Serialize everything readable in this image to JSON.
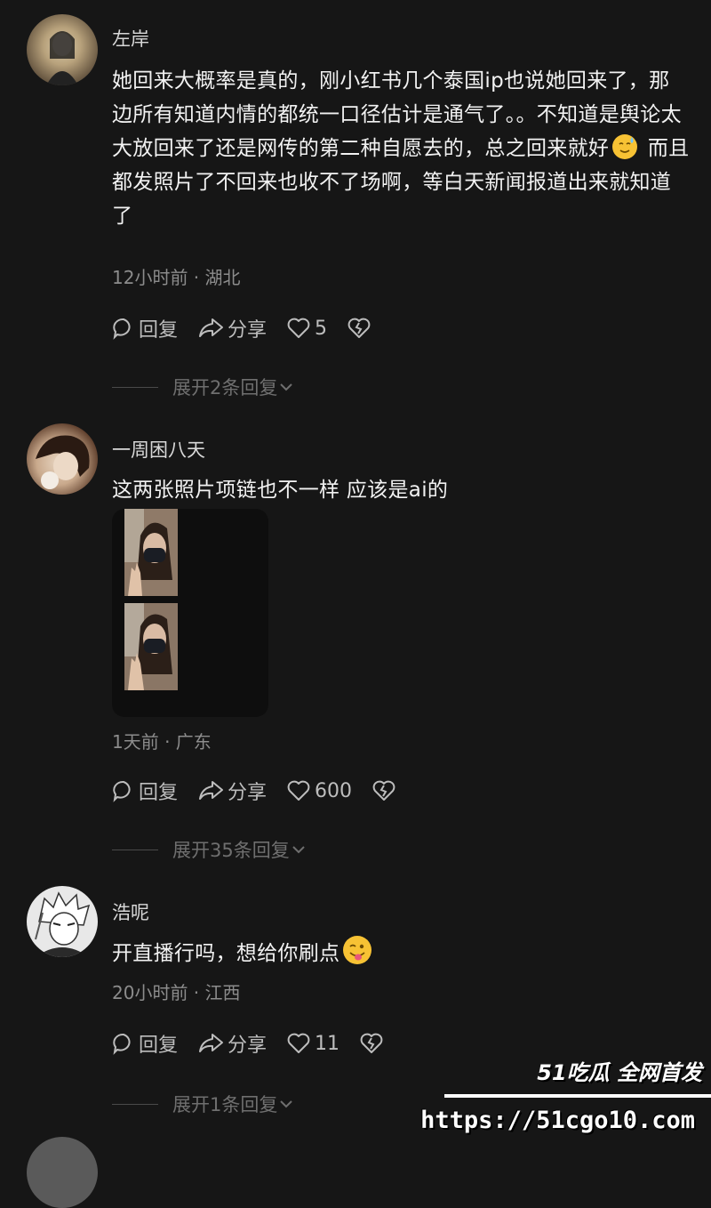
{
  "comments": [
    {
      "username": "左岸",
      "text_parts": [
        "她回来大概率是真的，刚小红书几个泰国ip也说她回来了，那边所有知道内情的都统一口径估计是通气了。。不知道是舆论太大放回来了还是网传的第二种自愿去的，总之回来就好",
        " 而且都发照片了不回来也收不了场啊，等白天新闻报道出来就知道了"
      ],
      "emoji": "sweat-smile-emoji",
      "meta": "12小时前 · 湖北",
      "reply_label": "回复",
      "share_label": "分享",
      "likes": "5",
      "expand_label": "展开2条回复"
    },
    {
      "username": "一周困八天",
      "text": "这两张照片项链也不一样 应该是ai的",
      "meta": "1天前 · 广东",
      "reply_label": "回复",
      "share_label": "分享",
      "likes": "600",
      "expand_label": "展开35条回复"
    },
    {
      "username": "浩呢",
      "text": "开直播行吗，想给你刷点",
      "emoji": "wink-tongue-emoji",
      "meta": "20小时前 · 江西",
      "reply_label": "回复",
      "share_label": "分享",
      "likes": "11",
      "expand_label": "展开1条回复"
    }
  ],
  "watermark": {
    "title": "51吃瓜 全网首发",
    "url": "https://51cgo10.com"
  },
  "colors": {
    "background": "#161616",
    "text": "#f2f2f2",
    "meta": "#8c8c8c",
    "emoji": "#f7c234"
  }
}
